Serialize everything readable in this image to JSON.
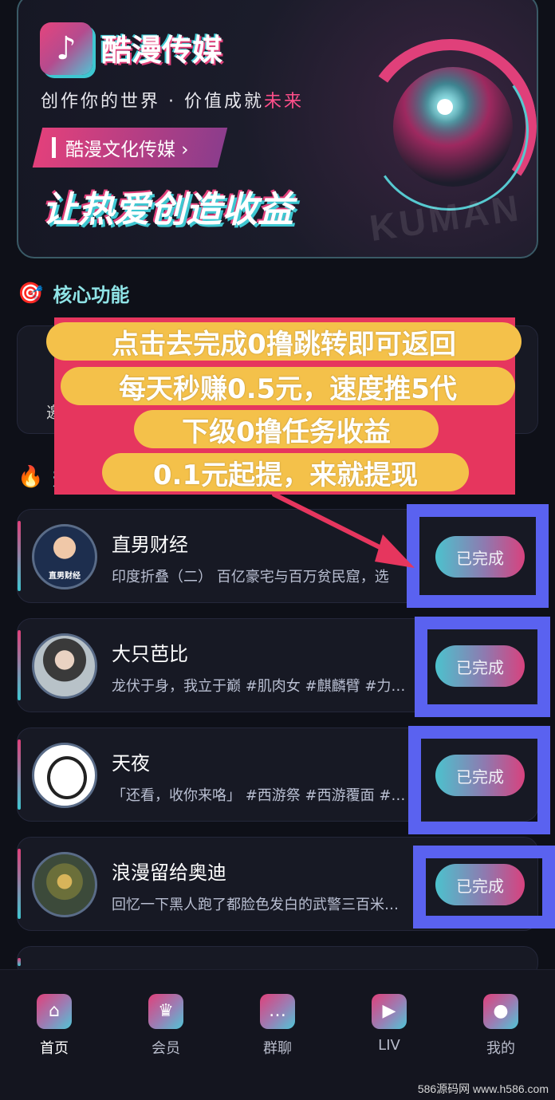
{
  "banner": {
    "brand_name": "酷漫传媒",
    "slogan_main": "创作你的世界 · 价值成就",
    "slogan_highlight": "未来",
    "tag": "酷漫文化传媒 ›",
    "headline": "让热爱创造收益",
    "watermark": "KUMAN",
    "logo_icon": "music-note-icon"
  },
  "sections": {
    "core_title": "核心功能",
    "core_icon": "target-icon",
    "core_item_partial": "邀",
    "hot_icon": "fire-icon",
    "hot_title_partial": "热"
  },
  "promo": {
    "lines": [
      "点击去完成0撸跳转即可返回",
      "每天秒赚0.5元，速度推5代",
      "下级0撸任务收益",
      "0.1元起提，来就提现"
    ],
    "colors": {
      "background": "#e6365e",
      "pill": "#f4c14a",
      "highlight_box": "#5a62f0"
    }
  },
  "tasks": [
    {
      "title": "直男财经",
      "desc": "印度折叠（二） 百亿豪宅与百万贫民窟，选",
      "button": "已完成",
      "avatar_caption": "直男财经"
    },
    {
      "title": "大只芭比",
      "desc": "龙伏于身，我立于巅 #肌肉女 #麒麟臂 #力…",
      "button": "已完成"
    },
    {
      "title": "天夜",
      "desc": "「还看，收你来咯」 #西游祭 #西游覆面 #…",
      "button": "已完成"
    },
    {
      "title": "浪漫留给奥迪",
      "desc": "回忆一下黑人跑了都脸色发白的武警三百米…",
      "button": "已完成"
    }
  ],
  "nav": [
    {
      "label": "首页",
      "icon": "home-icon",
      "glyph": "⌂"
    },
    {
      "label": "会员",
      "icon": "crown-vip-icon",
      "glyph": "♛"
    },
    {
      "label": "群聊",
      "icon": "chat-bubble-icon",
      "glyph": "…"
    },
    {
      "label": "LIV",
      "icon": "video-camera-icon",
      "glyph": "▶"
    },
    {
      "label": "我的",
      "icon": "user-icon",
      "glyph": "●"
    }
  ],
  "footer_watermark": "586源码网 www.h586.com"
}
